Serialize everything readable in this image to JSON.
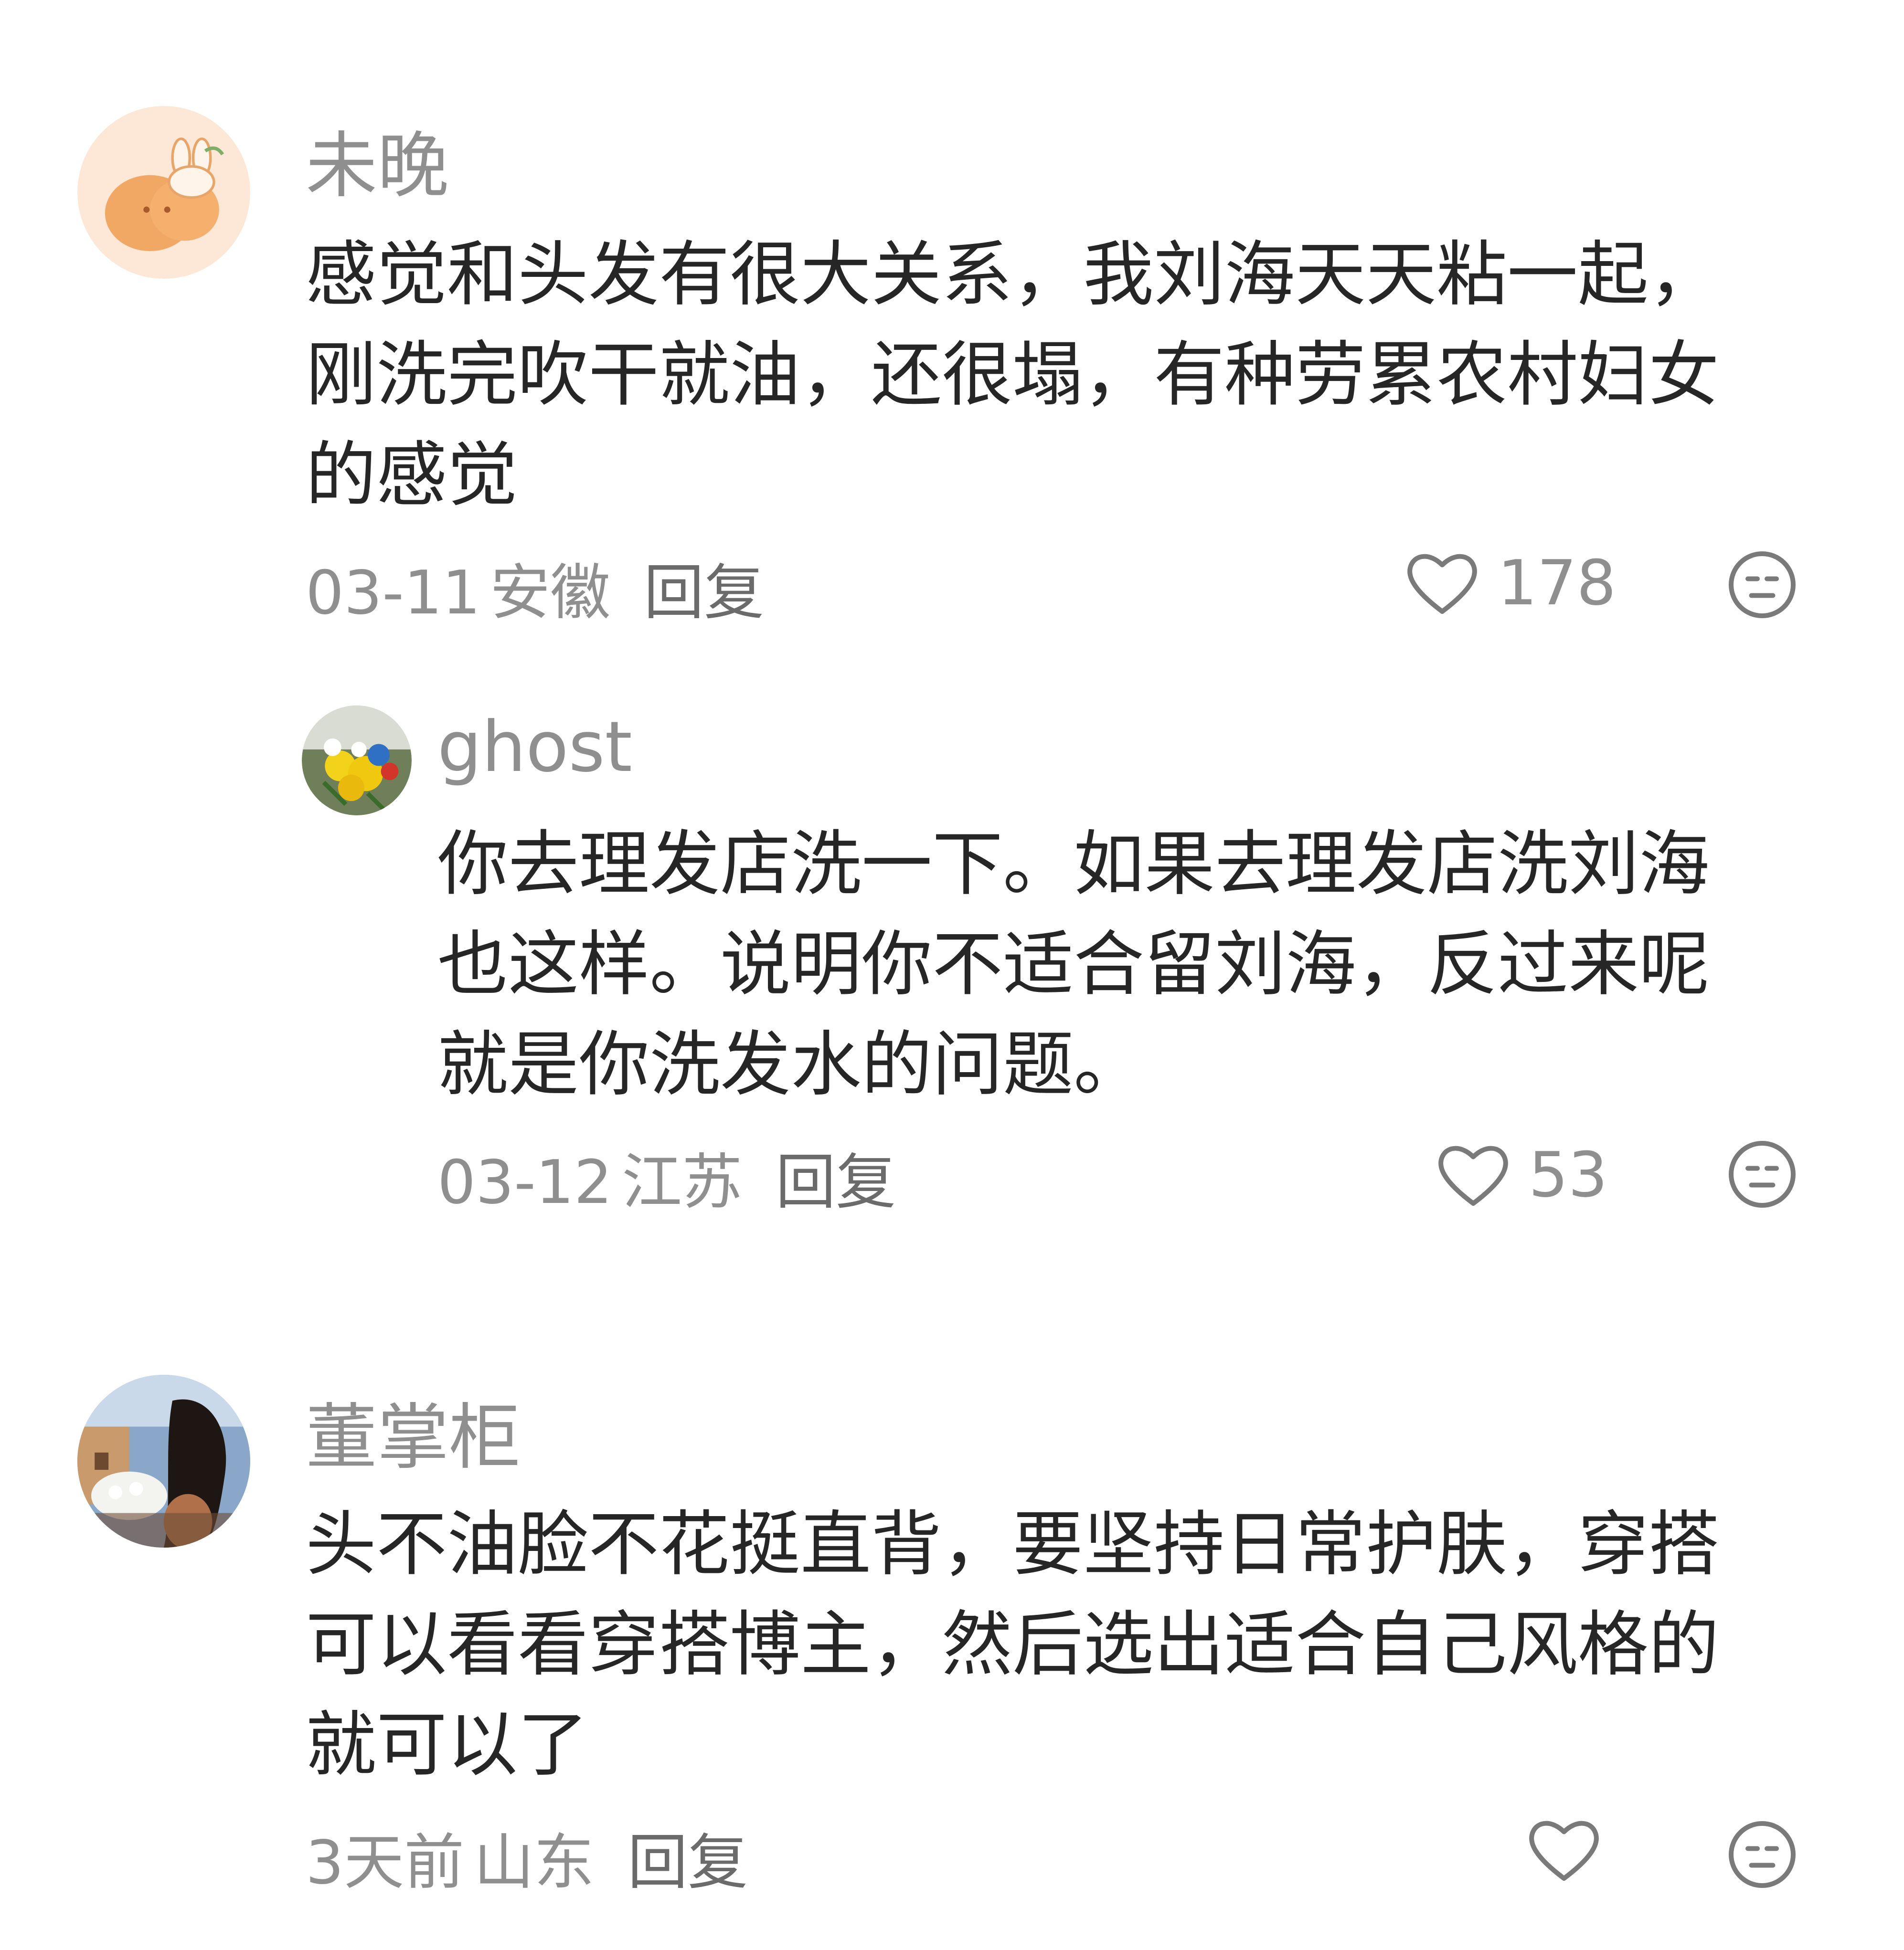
{
  "comments": [
    {
      "username": "未晚",
      "avatar_icon": "cartoon-bunny-avatar",
      "content_lines": [
        "感觉和头发有很大关系，我刘海天天粘一起，",
        "刚洗完吹干就油，还很塌，有种劳累农村妇女",
        "的感觉"
      ],
      "date": "03-11",
      "location": "安徽",
      "reply_label": "回复",
      "like_icon": "heart-outline-icon",
      "like_count": "178",
      "dislike_icon": "meh-face-icon"
    },
    {
      "username": "ghost",
      "avatar_icon": "flower-bouquet-avatar",
      "content_lines": [
        "你去理发店洗一下。如果去理发店洗刘海",
        "也这样。说明你不适合留刘海，反过来呢",
        "就是你洗发水的问题。"
      ],
      "date": "03-12",
      "location": "江苏",
      "reply_label": "回复",
      "like_icon": "heart-outline-icon",
      "like_count": "53",
      "dislike_icon": "meh-face-icon"
    },
    {
      "username": "董掌柜",
      "avatar_icon": "woman-city-street-avatar",
      "content_lines": [
        "头不油脸不花挺直背，要坚持日常护肤，穿搭",
        "可以看看穿搭博主，然后选出适合自己风格的",
        "就可以了"
      ],
      "date": "3天前",
      "location": "山东",
      "reply_label": "回复",
      "like_icon": "heart-outline-icon",
      "like_count": "",
      "dislike_icon": "meh-face-icon"
    }
  ],
  "colors": {
    "username": "#8f8f8f",
    "content": "#262626",
    "meta": "#8f8f8f",
    "icon_stroke": "#7a7a7a"
  }
}
